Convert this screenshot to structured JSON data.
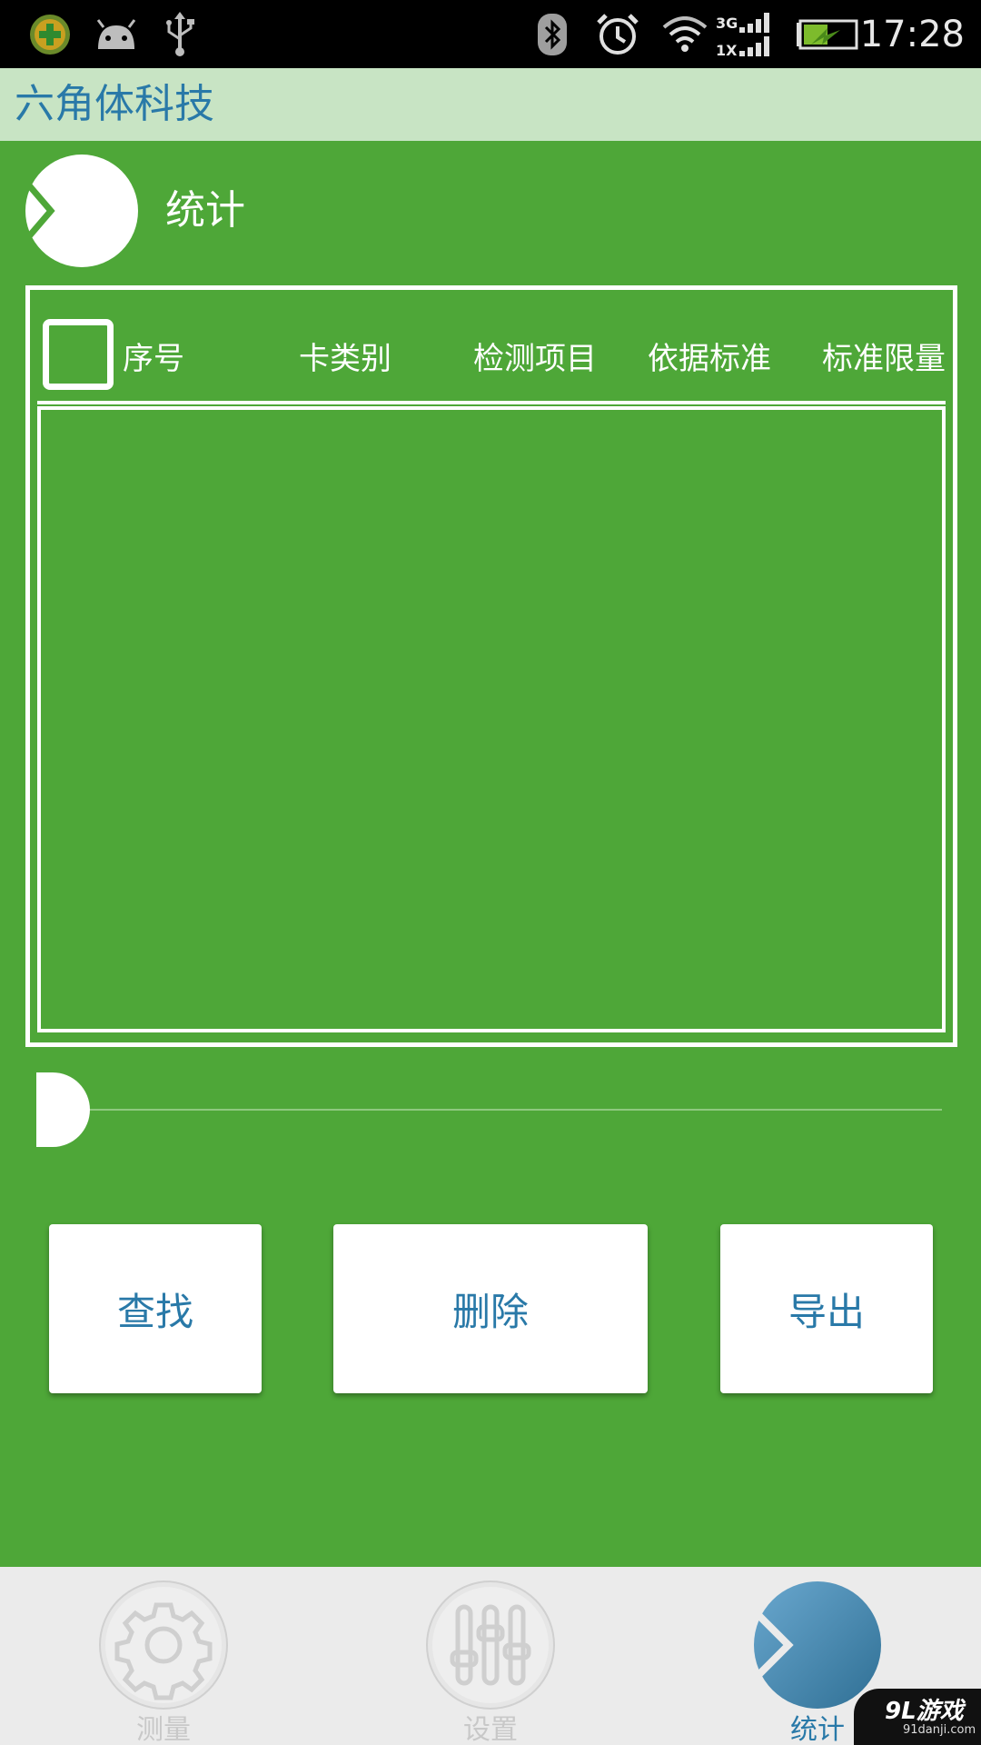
{
  "status_bar": {
    "time": "17:28",
    "network_top": "3G",
    "network_bottom": "1X",
    "icons": [
      "app-notification-icon",
      "android-icon",
      "usb-icon",
      "bluetooth-icon",
      "alarm-icon",
      "wifi-icon",
      "signal-icon",
      "battery-charging-icon"
    ]
  },
  "app": {
    "title": "六角体科技"
  },
  "section": {
    "title": "统计",
    "icon": "pie-chart-icon"
  },
  "table": {
    "columns": [
      "序号",
      "卡类别",
      "检测项目",
      "依据标准",
      "标准限量"
    ],
    "rows": []
  },
  "slider": {
    "value": 0
  },
  "actions": {
    "search": "查找",
    "delete": "删除",
    "export": "导出"
  },
  "bottom_nav": {
    "items": [
      {
        "label": "测量",
        "icon": "gear-icon",
        "active": false
      },
      {
        "label": "设置",
        "icon": "sliders-icon",
        "active": false
      },
      {
        "label": "统计",
        "icon": "pie-chart-icon",
        "active": true
      }
    ]
  },
  "watermark": {
    "brand": "9L游戏",
    "domain": "91danji.com"
  },
  "colors": {
    "background": "#4ea738",
    "title_bar": "#c8e4c4",
    "accent_blue": "#2979a8",
    "nav_bg": "#ebebeb"
  }
}
